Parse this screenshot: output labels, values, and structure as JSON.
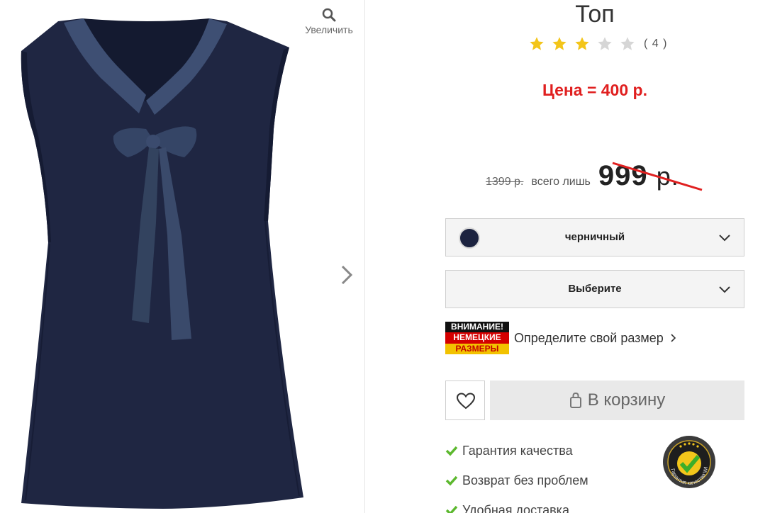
{
  "gallery": {
    "zoom_label": "Увеличить"
  },
  "product": {
    "title": "Топ",
    "rating": {
      "value": 3,
      "max": 5,
      "count_label": "( 4 )"
    },
    "promo": "Цена = 400 р.",
    "old_price": "1399 р.",
    "only_label": "всего лишь",
    "new_price": "999",
    "currency": "р."
  },
  "options": {
    "color": {
      "label": "черничный",
      "swatch": "#1c2340"
    },
    "size": {
      "label": "Выберите"
    }
  },
  "size_hint": {
    "badge": [
      "ВНИМАНИЕ!",
      "НЕМЕЦКИЕ",
      "РАЗМЕРЫ"
    ],
    "link": "Определите свой размер"
  },
  "cart": {
    "label": "В корзину"
  },
  "benefits": [
    "Гарантия качества",
    "Возврат без проблем",
    "Удобная доставка"
  ],
  "seal_text": "Гарантия качества WITT",
  "colors": {
    "promo": "#e01f1f",
    "check": "#5cb82e",
    "star_on": "#f3c51a",
    "star_off": "#d6d6d6"
  }
}
